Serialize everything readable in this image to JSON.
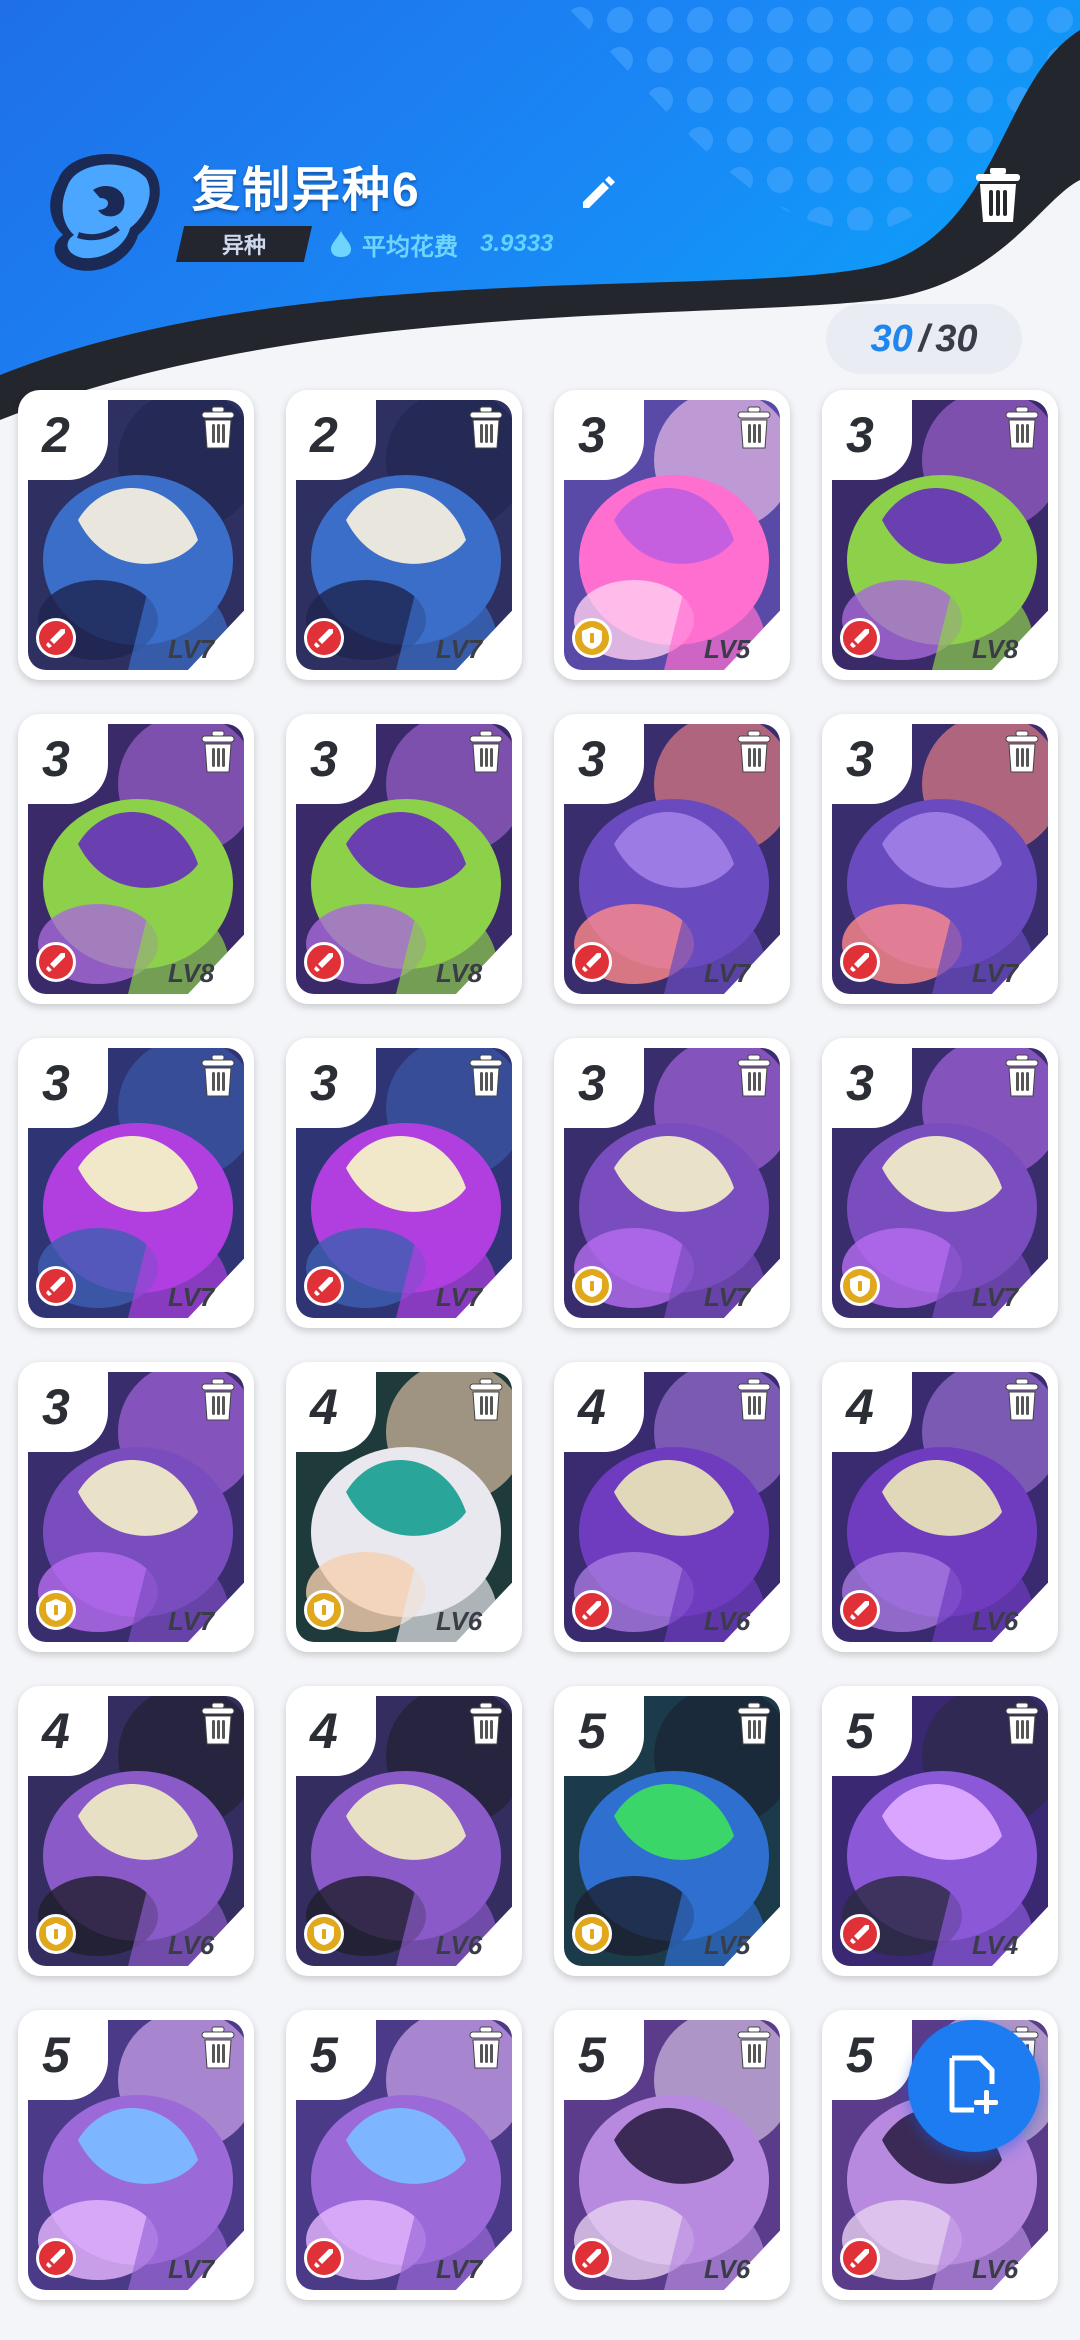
{
  "header": {
    "deck_name": "复制异种6",
    "tag": "异种",
    "avg_cost_label": "平均花费",
    "avg_cost_value": "3.9333",
    "icons": {
      "deck": "alien-skull-icon",
      "edit": "pencil-icon",
      "delete": "trash-icon"
    }
  },
  "deck_count": {
    "current": "30",
    "separator": "/",
    "max": "30"
  },
  "colors": {
    "header_blue": "#1f7ef0",
    "header_dark": "#24262d",
    "attack_badge": "#e03038",
    "defense_badge": "#e0a81a",
    "fab_blue": "#1d7cf2"
  },
  "cards": [
    {
      "cost": "2",
      "level": "LV7",
      "role": "attack",
      "art": "bone"
    },
    {
      "cost": "2",
      "level": "LV7",
      "role": "attack",
      "art": "bone"
    },
    {
      "cost": "3",
      "level": "LV5",
      "role": "defense",
      "art": "pink"
    },
    {
      "cost": "3",
      "level": "LV8",
      "role": "attack",
      "art": "green"
    },
    {
      "cost": "3",
      "level": "LV8",
      "role": "attack",
      "art": "green"
    },
    {
      "cost": "3",
      "level": "LV8",
      "role": "attack",
      "art": "green"
    },
    {
      "cost": "3",
      "level": "LV7",
      "role": "attack",
      "art": "bulb"
    },
    {
      "cost": "3",
      "level": "LV7",
      "role": "attack",
      "art": "bulb"
    },
    {
      "cost": "3",
      "level": "LV7",
      "role": "attack",
      "art": "horn"
    },
    {
      "cost": "3",
      "level": "LV7",
      "role": "attack",
      "art": "horn"
    },
    {
      "cost": "3",
      "level": "LV7",
      "role": "defense",
      "art": "shell"
    },
    {
      "cost": "3",
      "level": "LV7",
      "role": "defense",
      "art": "shell"
    },
    {
      "cost": "3",
      "level": "LV7",
      "role": "defense",
      "art": "shell"
    },
    {
      "cost": "4",
      "level": "LV6",
      "role": "defense",
      "art": "hero"
    },
    {
      "cost": "4",
      "level": "LV6",
      "role": "attack",
      "art": "mantis"
    },
    {
      "cost": "4",
      "level": "LV6",
      "role": "attack",
      "art": "mantis"
    },
    {
      "cost": "4",
      "level": "LV6",
      "role": "defense",
      "art": "mushroom"
    },
    {
      "cost": "4",
      "level": "LV6",
      "role": "defense",
      "art": "mushroom"
    },
    {
      "cost": "5",
      "level": "LV5",
      "role": "defense",
      "art": "robot"
    },
    {
      "cost": "5",
      "level": "LV4",
      "role": "attack",
      "art": "witch"
    },
    {
      "cost": "5",
      "level": "LV7",
      "role": "attack",
      "art": "crystal"
    },
    {
      "cost": "5",
      "level": "LV7",
      "role": "attack",
      "art": "crystal"
    },
    {
      "cost": "5",
      "level": "LV6",
      "role": "attack",
      "art": "reaper"
    },
    {
      "cost": "5",
      "level": "LV6",
      "role": "attack",
      "art": "reaper"
    }
  ],
  "fab": {
    "icon": "add-card-icon"
  }
}
